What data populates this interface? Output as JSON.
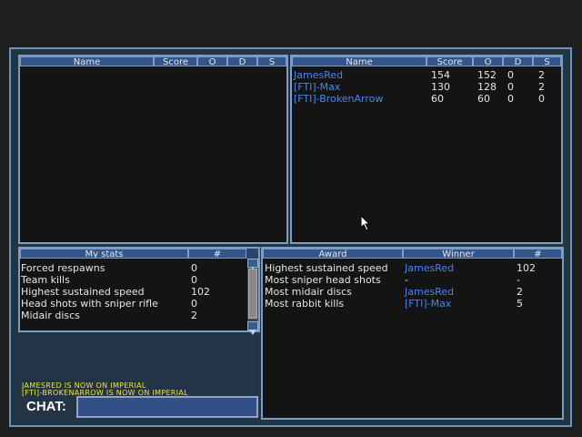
{
  "team_left": {
    "headers": [
      "Name",
      "Score",
      "O",
      "D",
      "S"
    ],
    "rows": []
  },
  "team_right": {
    "headers": [
      "Name",
      "Score",
      "O",
      "D",
      "S"
    ],
    "rows": [
      {
        "name": "JamesRed",
        "score": "154",
        "o": "152",
        "d": "0",
        "s": "2"
      },
      {
        "name": "[FTI]-Max",
        "score": "130",
        "o": "128",
        "d": "0",
        "s": "2"
      },
      {
        "name": "[FTI]-BrokenArrow",
        "score": "60",
        "o": "60",
        "d": "0",
        "s": "0"
      }
    ]
  },
  "my_stats": {
    "headers": [
      "My stats",
      "#"
    ],
    "rows": [
      {
        "label": "Forced respawns",
        "value": "0"
      },
      {
        "label": "Team kills",
        "value": "0"
      },
      {
        "label": "Highest sustained speed",
        "value": "102"
      },
      {
        "label": "Head shots with sniper rifle",
        "value": "0"
      },
      {
        "label": "Midair discs",
        "value": "2"
      }
    ]
  },
  "awards": {
    "headers": [
      "Award",
      "Winner",
      "#"
    ],
    "rows": [
      {
        "award": "Highest sustained speed",
        "winner": "JamesRed",
        "count": "102"
      },
      {
        "award": "Most sniper head shots",
        "winner": "-",
        "count": "-"
      },
      {
        "award": "Most midair discs",
        "winner": "JamesRed",
        "count": "2"
      },
      {
        "award": "Most rabbit kills",
        "winner": "[FTI]-Max",
        "count": "5"
      }
    ]
  },
  "messages": [
    "JAMESRED IS NOW ON IMPERIAL",
    "[FTI]-BROKENARROW IS NOW ON IMPERIAL"
  ],
  "chat": {
    "label": "CHAT:",
    "value": ""
  },
  "colors": {
    "accent": "#4a86ee",
    "system_text": "#f3e438",
    "panel_border": "#7b9dc2"
  }
}
